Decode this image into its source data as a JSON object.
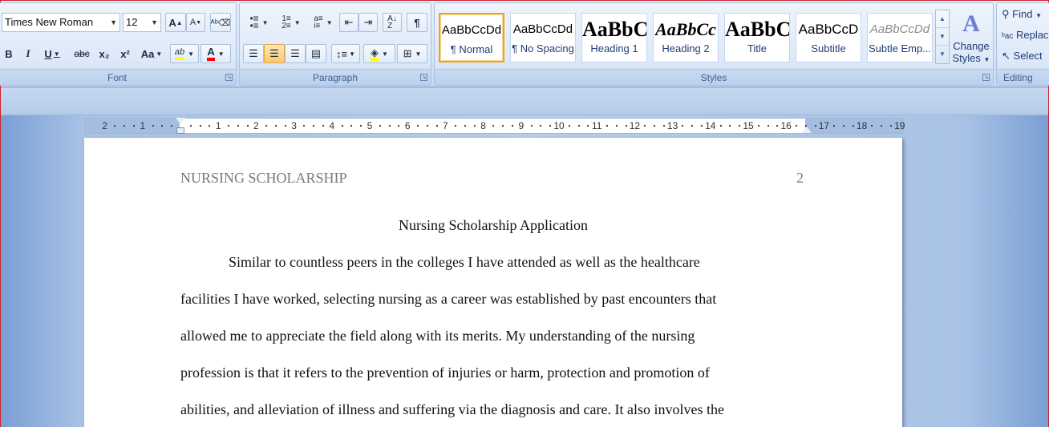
{
  "font_group": {
    "label": "Font",
    "font_name": "Times New Roman",
    "font_size": "12",
    "grow_font": "A",
    "shrink_font": "A",
    "bold": "B",
    "italic": "I",
    "underline": "U",
    "strikethrough": "abc",
    "subscript": "x₂",
    "superscript": "x²",
    "change_case": "Aa",
    "highlight": "ab",
    "font_color": "A"
  },
  "paragraph_group": {
    "label": "Paragraph",
    "pilcrow": "¶"
  },
  "styles_group": {
    "label": "Styles",
    "items": [
      {
        "sample": "AaBbCcDd",
        "name": "¶ Normal"
      },
      {
        "sample": "AaBbCcDd",
        "name": "¶ No Spacing"
      },
      {
        "sample": "AaBbC(",
        "name": "Heading 1"
      },
      {
        "sample": "AaBbCc",
        "name": "Heading 2"
      },
      {
        "sample": "AaBbC(",
        "name": "Title"
      },
      {
        "sample": "AaBbCcD",
        "name": "Subtitle"
      },
      {
        "sample": "AaBbCcDd",
        "name": "Subtle Emp..."
      }
    ],
    "change_styles_line1": "Change",
    "change_styles_line2": "Styles"
  },
  "editing_group": {
    "label": "Editing",
    "find": "Find",
    "replace": "Replac",
    "select": "Select"
  },
  "ruler": {
    "left_labels": [
      "2",
      "1"
    ],
    "right_labels": [
      "1",
      "2",
      "3",
      "4",
      "5",
      "6",
      "7",
      "8",
      "9",
      "10",
      "11",
      "12",
      "13",
      "14",
      "15",
      "16",
      "17",
      "18",
      "19"
    ]
  },
  "document": {
    "running_head": "NURSING SCHOLARSHIP",
    "page_number": "2",
    "title": "Nursing Scholarship Application",
    "lines": [
      "Similar to countless peers in the colleges I have attended as well as the healthcare",
      "facilities I have worked, selecting nursing as a career was established by past encounters that",
      "allowed me to appreciate the field along with its merits. My understanding of the nursing",
      "profession is that it refers to the prevention of injuries or harm, protection and promotion of",
      "abilities, and alleviation of illness and suffering via the diagnosis and care. It also involves the"
    ]
  },
  "colors": {
    "ribbon": "#dde9f8",
    "selected_style_border": "#e8a238",
    "highlight_yellow": "#ffff00",
    "font_color_red": "#ff0000",
    "running_head": "#7a7a7a"
  }
}
